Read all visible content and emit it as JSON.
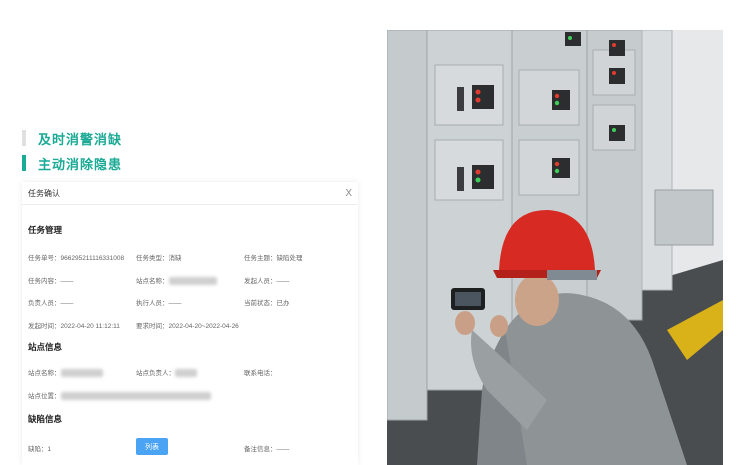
{
  "headlines": [
    "及时消警消缺",
    "主动消除隐患"
  ],
  "dialog": {
    "title": "任务确认",
    "close": "X",
    "sections": {
      "task": "任务管理",
      "site": "站点信息",
      "defect": "缺陷信息"
    },
    "task_fields": {
      "no_label": "任务单号：",
      "no_value": "966295211116331008",
      "type_label": "任务类型：",
      "type_value": "消缺",
      "subject_label": "任务主题：",
      "subject_value": "缺陷处理",
      "content_label": "任务内容：",
      "content_value": "——",
      "station_label": "站点名称：",
      "initiator_label": "发起人员：",
      "initiator_value": "——",
      "owner_label": "负责人员：",
      "owner_value": "——",
      "executor_label": "执行人员：",
      "executor_value": "——",
      "status_label": "当前状态：",
      "status_value": "已办",
      "start_label": "发起时间：",
      "start_value": "2022-04-20 11:12:11",
      "due_label": "要求时间：",
      "due_value": "2022-04-20~2022-04-26"
    },
    "site_fields": {
      "name_label": "站点名称：",
      "manager_label": "站点负责人：",
      "phone_label": "联系电话：",
      "location_label": "站点位置："
    },
    "defect_fields": {
      "defect_label": "缺陷：",
      "defect_value": "1",
      "list_button": "列表",
      "remark_label": "备注信息：",
      "remark_value": "——"
    }
  },
  "colors": {
    "accent": "#1aaa95",
    "button": "#4aa3f3",
    "helmet": "#d62a22"
  }
}
